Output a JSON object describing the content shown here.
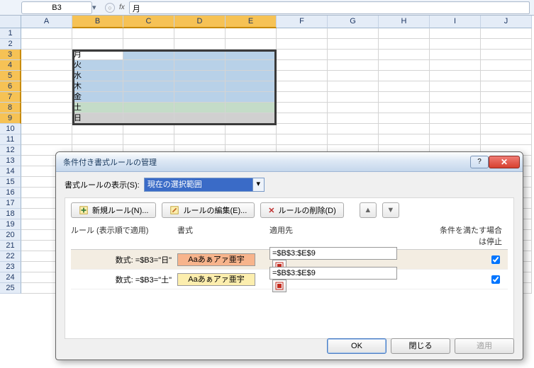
{
  "namebox": {
    "ref": "B3",
    "fx_label": "fx"
  },
  "formula_bar": {
    "value": "月"
  },
  "columns": [
    "A",
    "B",
    "C",
    "D",
    "E",
    "F",
    "G",
    "H",
    "I",
    "J"
  ],
  "rows": [
    "1",
    "2",
    "3",
    "4",
    "5",
    "6",
    "7",
    "8",
    "9",
    "10",
    "11",
    "12",
    "13",
    "14",
    "15",
    "16",
    "17",
    "18",
    "19",
    "20",
    "21",
    "22",
    "23",
    "24",
    "25"
  ],
  "days": [
    "月",
    "火",
    "水",
    "木",
    "金",
    "土",
    "日"
  ],
  "dialog": {
    "title": "条件付き書式ルールの管理",
    "show_label": "書式ルールの表示(S):",
    "show_value": "現在の選択範囲",
    "btn_new": "新規ルール(N)...",
    "btn_edit": "ルールの編集(E)...",
    "btn_delete": "ルールの削除(D)",
    "hdr_rule": "ルール (表示順で適用)",
    "hdr_format": "書式",
    "hdr_apply": "適用先",
    "hdr_stop": "条件を満たす場合は停止",
    "rules": [
      {
        "rule": "数式: =$B3=\"日\"",
        "preview": "Aaあぁアァ亜宇",
        "applies": "=$B$3:$E$9",
        "stop": true
      },
      {
        "rule": "数式: =$B3=\"土\"",
        "preview": "Aaあぁアァ亜宇",
        "applies": "=$B$3:$E$9",
        "stop": true
      }
    ],
    "ok": "OK",
    "close": "閉じる",
    "apply": "適用"
  }
}
